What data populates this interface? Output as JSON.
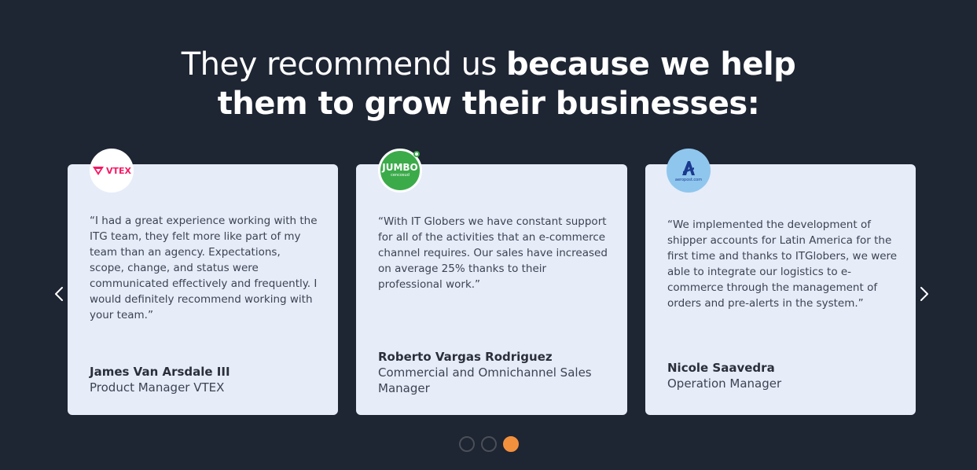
{
  "heading": {
    "light": "They recommend us ",
    "bold_1": "because we help",
    "bold_2": "them to grow their businesses:"
  },
  "testimonials": [
    {
      "logo": "VTEX",
      "quote": "“I had a great experience working with the ITG team, they felt more like part of my team than an agency. Expectations, scope, change, and status were communicated effectively and frequently. I would definitely recommend working with your team.”",
      "name": "James Van Arsdale III",
      "role": "Product Manager VTEX"
    },
    {
      "logo": "JUMBO",
      "logo_sub": "cencosud",
      "quote": "“With IT Globers we have constant support for all of the activities that an e-commerce channel requires. Our sales have increased on average 25% thanks to their professional work.”",
      "name": "Roberto Vargas Rodriguez",
      "role": "Commercial and Omnichannel Sales Manager"
    },
    {
      "logo_sub": "aeropost.com",
      "quote": "“We implemented the development of shipper accounts for Latin America for the first time and thanks to ITGlobers, we were able to integrate our logistics to e-commerce through the management of orders and pre-alerts in the system.”",
      "name": "Nicole Saavedra",
      "role": "Operation Manager"
    }
  ],
  "carousel": {
    "prev_icon": "chevron-left-icon",
    "next_icon": "chevron-right-icon",
    "pages": 3,
    "active_page": 3
  },
  "colors": {
    "background": "#1e2533",
    "card": "#e6ecf8",
    "active_dot": "#f2913d",
    "vtex_brand": "#f71963",
    "jumbo_brand": "#3bab4a",
    "aeropost_brand": "#8fc6ee"
  }
}
